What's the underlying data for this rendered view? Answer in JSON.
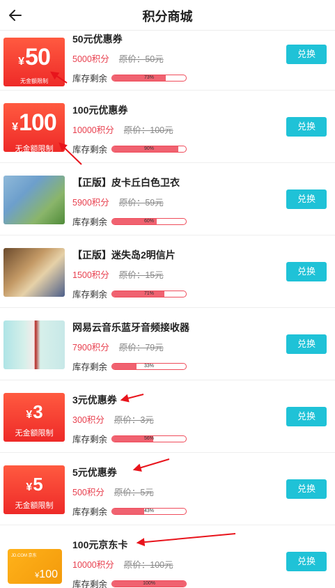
{
  "header": {
    "title": "积分商城",
    "back_icon": "back-arrow-icon"
  },
  "labels": {
    "stock": "库存剩余",
    "redeem": "兑换"
  },
  "items": [
    {
      "name": "50元优惠券",
      "points": "5000积分",
      "original": "原价：50元",
      "stock_pct_label": "73%",
      "stock_fraction": 0.73,
      "thumb": {
        "type": "coupon",
        "amount": "50",
        "yen": "¥",
        "note": "无金额限制"
      }
    },
    {
      "name": "100元优惠券",
      "points": "10000积分",
      "original": "原价：100元",
      "stock_pct_label": "90%",
      "stock_fraction": 0.9,
      "thumb": {
        "type": "coupon",
        "amount": "100",
        "yen": "¥",
        "note": "无金额限制"
      }
    },
    {
      "name": "【正版】皮卡丘白色卫衣",
      "points": "5900积分",
      "original": "原价：59元",
      "stock_pct_label": "60%",
      "stock_fraction": 0.6,
      "thumb": {
        "type": "photo"
      }
    },
    {
      "name": "【正版】迷失岛2明信片",
      "points": "1500积分",
      "original": "原价：15元",
      "stock_pct_label": "71%",
      "stock_fraction": 0.71,
      "thumb": {
        "type": "photo"
      }
    },
    {
      "name": "网易云音乐蓝牙音频接收器",
      "points": "7900积分",
      "original": "原价：79元",
      "stock_pct_label": "33%",
      "stock_fraction": 0.33,
      "thumb": {
        "type": "photo"
      }
    },
    {
      "name": "3元优惠券",
      "points": "300积分",
      "original": "原价：3元",
      "stock_pct_label": "56%",
      "stock_fraction": 0.56,
      "thumb": {
        "type": "coupon",
        "amount": "3",
        "yen": "¥",
        "note": "无金额限制"
      }
    },
    {
      "name": "5元优惠券",
      "points": "500积分",
      "original": "原价：5元",
      "stock_pct_label": "43%",
      "stock_fraction": 0.43,
      "thumb": {
        "type": "coupon",
        "amount": "5",
        "yen": "¥",
        "note": "无金额限制"
      }
    },
    {
      "name": "100元京东卡",
      "points": "10000积分",
      "original": "原价：100元",
      "stock_pct_label": "100%",
      "stock_fraction": 1.0,
      "thumb": {
        "type": "jd-card",
        "logo": "JD.COM 京东",
        "amount": "100",
        "yen": "¥"
      }
    }
  ],
  "colors": {
    "accent": "#1fc2d7",
    "points": "#e8404f",
    "bar": "#f06270",
    "annotation_arrow": "#e8141c"
  }
}
